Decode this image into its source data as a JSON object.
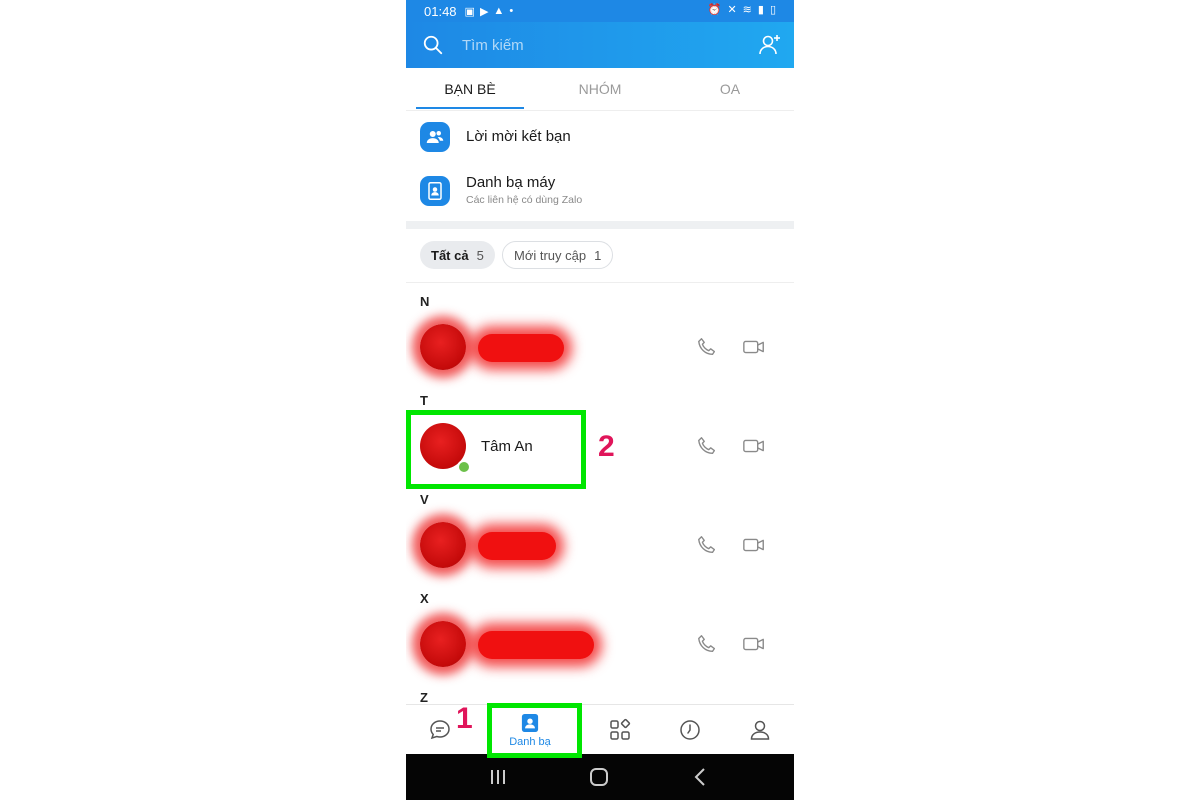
{
  "status_bar": {
    "time": "01:48"
  },
  "search": {
    "placeholder": "Tìm kiếm"
  },
  "tabs": [
    {
      "label": "BẠN BÈ",
      "active": true
    },
    {
      "label": "NHÓM",
      "active": false
    },
    {
      "label": "OA",
      "active": false
    }
  ],
  "menu": {
    "friend_requests": {
      "title": "Lời mời kết bạn",
      "icon": "friend-request-icon"
    },
    "phone_contacts": {
      "title": "Danh bạ máy",
      "subtitle": "Các liên hệ có dùng Zalo",
      "icon": "phonebook-icon"
    }
  },
  "filters": {
    "all": {
      "label": "Tất cả",
      "count": "5"
    },
    "recent": {
      "label": "Mới truy cập",
      "count": "1"
    }
  },
  "contacts": {
    "sections": [
      "N",
      "T",
      "V",
      "X",
      "Z"
    ],
    "t_contact": {
      "name": "Tâm An",
      "online": true
    }
  },
  "bottom_nav": {
    "items": [
      {
        "icon": "chat-icon",
        "label": ""
      },
      {
        "icon": "contacts-icon",
        "label": "Danh bạ",
        "active": true
      },
      {
        "icon": "discover-icon",
        "label": ""
      },
      {
        "icon": "timeline-clock-icon",
        "label": ""
      },
      {
        "icon": "profile-icon",
        "label": ""
      }
    ]
  },
  "annotations": {
    "step1": "1",
    "step2": "2"
  },
  "colors": {
    "accent": "#1e88e5",
    "highlight": "#00e600",
    "annotation_number": "#e0155a",
    "online": "#6cc04a"
  }
}
